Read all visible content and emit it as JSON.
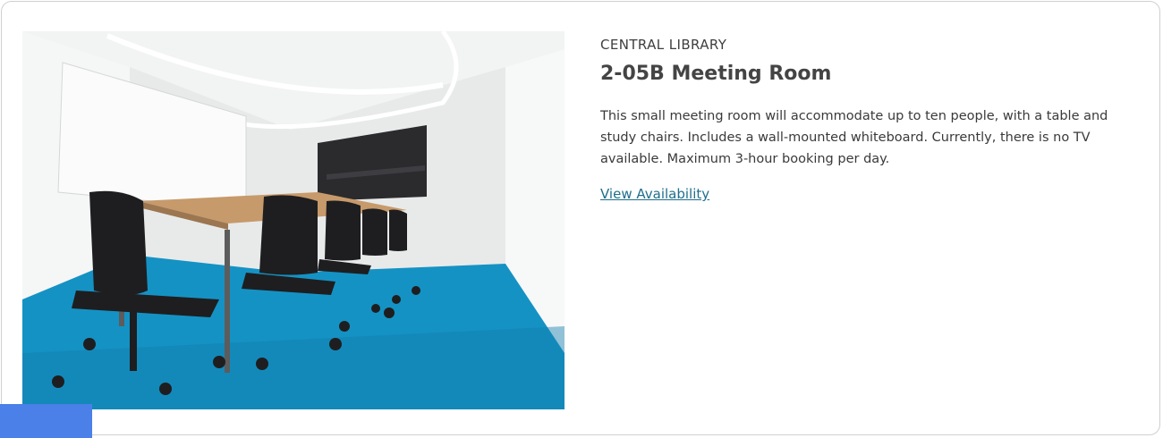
{
  "room": {
    "location": "CENTRAL LIBRARY",
    "name": "2-05B Meeting Room",
    "description": "This small meeting room will accommodate up to ten people, with a table and study chairs. Includes a wall-mounted whiteboard. Currently, there is no TV available. Maximum 3-hour booking per day.",
    "availability_link": "View Availability"
  },
  "colors": {
    "link": "#1f6e8c",
    "accent_tab": "#4a80e8",
    "carpet": "#1592c4"
  }
}
